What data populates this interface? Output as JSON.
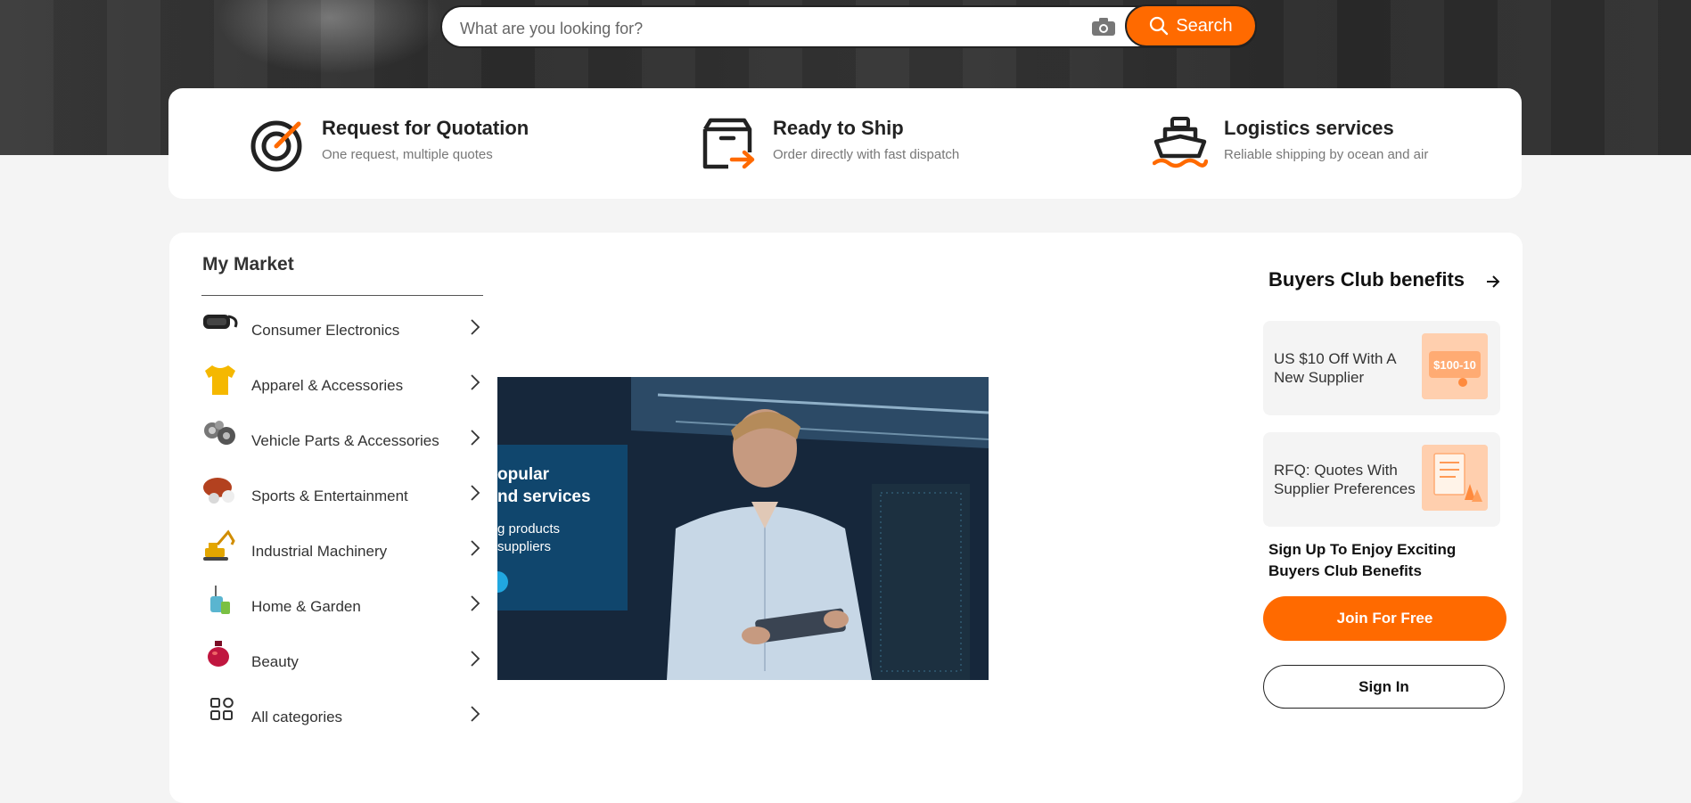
{
  "search": {
    "placeholder": "What are you looking for?",
    "button_label": "Search"
  },
  "services": [
    {
      "title": "Request for Quotation",
      "subtitle": "One request, multiple quotes",
      "icon": "target-icon"
    },
    {
      "title": "Ready to Ship",
      "subtitle": "Order directly with fast dispatch",
      "icon": "box-arrow-icon"
    },
    {
      "title": "Logistics services",
      "subtitle": "Reliable shipping by ocean and air",
      "icon": "ship-icon"
    }
  ],
  "market": {
    "title": "My Market",
    "categories": [
      {
        "label": "Consumer Electronics",
        "icon": "vr-headset-icon"
      },
      {
        "label": "Apparel & Accessories",
        "icon": "tshirt-icon"
      },
      {
        "label": "Vehicle Parts & Accessories",
        "icon": "engine-parts-icon"
      },
      {
        "label": "Sports & Entertainment",
        "icon": "sports-balls-icon"
      },
      {
        "label": "Industrial Machinery",
        "icon": "excavator-icon"
      },
      {
        "label": "Home & Garden",
        "icon": "garden-tools-icon"
      },
      {
        "label": "Beauty",
        "icon": "perfume-icon"
      },
      {
        "label": "All categories",
        "icon": "grid-icon"
      }
    ]
  },
  "banner": {
    "line1": "opular",
    "line2": "nd services",
    "line3": "g products",
    "line4": "suppliers"
  },
  "buyers_club": {
    "title": "Buyers Club benefits",
    "benefits": [
      {
        "text": "US $10 Off With A New Supplier",
        "image_text": "$100-10"
      },
      {
        "text": "RFQ: Quotes With Supplier Preferences"
      }
    ],
    "signup_text": "Sign Up To Enjoy Exciting Buyers Club Benefits",
    "join_label": "Join For Free",
    "signin_label": "Sign In"
  },
  "colors": {
    "accent": "#ff6a00",
    "background": "#f4f4f4",
    "card": "#ffffff"
  }
}
